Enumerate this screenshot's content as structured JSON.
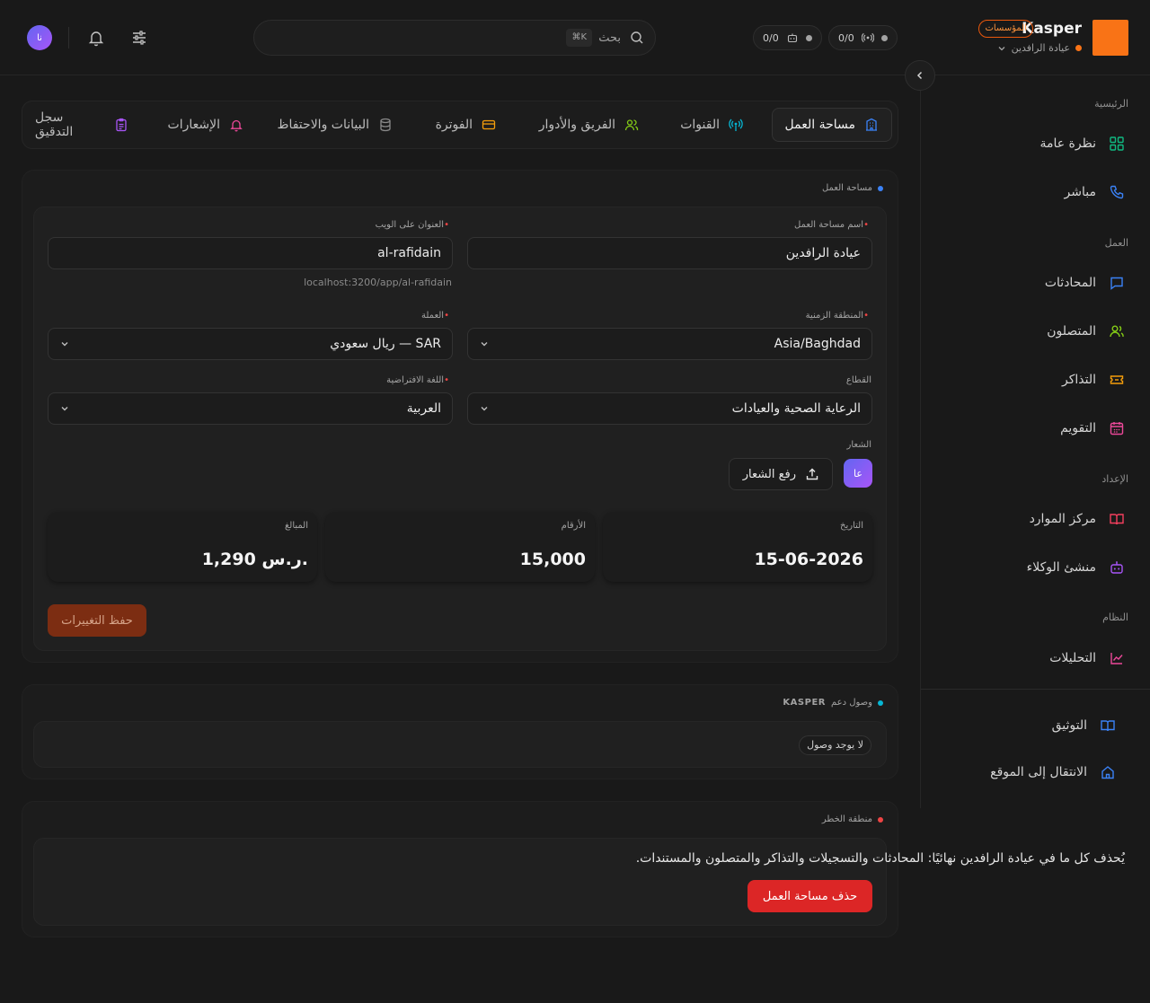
{
  "header": {
    "brand": "Kasper",
    "badge": "المؤسسات",
    "workspace": "عيادة الرافدين",
    "counter_channels": "0/0",
    "counter_agents": "0/0",
    "search_placeholder": "بحث",
    "search_shortcut": "⌘K",
    "avatar_initials": "نا"
  },
  "sidebar": {
    "sections": {
      "home": "الرئيسية",
      "work": "العمل",
      "setup": "الإعداد",
      "system": "النظام"
    },
    "items": {
      "overview": "نظرة عامة",
      "live": "مباشر",
      "conversations": "المحادثات",
      "contacts": "المتصلون",
      "tickets": "التذاكر",
      "calendar": "التقويم",
      "resources": "مركز الموارد",
      "agents": "منشئ الوكلاء",
      "analytics": "التحليلات",
      "docs": "التوثيق",
      "go_site": "الانتقال إلى الموقع"
    }
  },
  "tabs": {
    "workspace": "مساحة العمل",
    "channels": "القنوات",
    "team": "الفريق والأدوار",
    "billing": "الفوترة",
    "data": "البيانات والاحتفاظ",
    "notifications": "الإشعارات",
    "audit": "سجل التدقيق"
  },
  "workspace_card": {
    "label": "مساحة العمل",
    "name_label": "اسم مساحة العمل",
    "name_value": "عيادة الرافدين",
    "web_label": "العنوان على الويب",
    "web_value": "al-rafidain",
    "web_hint": "localhost:3200/app/al-rafidain",
    "tz_label": "المنطقة الزمنية",
    "tz_value": "Asia/Baghdad",
    "currency_label": "العملة",
    "currency_value": "SAR — ريال سعودي",
    "sector_label": "القطاع",
    "sector_value": "الرعاية الصحية والعيادات",
    "lang_label": "اللغة الافتراضية",
    "lang_value": "العربية",
    "logo_label": "الشعار",
    "upload_label": "رفع الشعار",
    "logo_initials": "عا",
    "stats": {
      "date_label": "التاريخ",
      "date_value": "15-06-2026",
      "numbers_label": "الأرقام",
      "numbers_value": "15,000",
      "amounts_label": "المبالغ",
      "amounts_value": "1,290 ر.س."
    },
    "save_label": "حفظ التغييرات"
  },
  "support_card": {
    "label_prefix": "وصول دعم",
    "label_brand": "KASPER",
    "status": "لا يوجد وصول"
  },
  "danger_card": {
    "label": "منطقة الخطر",
    "text": "يُحذف كل ما في عيادة الرافدين نهائيًا: المحادثات والتسجيلات والتذاكر والمتصلون والمستندات.",
    "button": "حذف مساحة العمل"
  },
  "colors": {
    "accent": "#f97316",
    "danger": "#dc2626",
    "blue": "#3b82f6",
    "cyan": "#06b6d4"
  }
}
